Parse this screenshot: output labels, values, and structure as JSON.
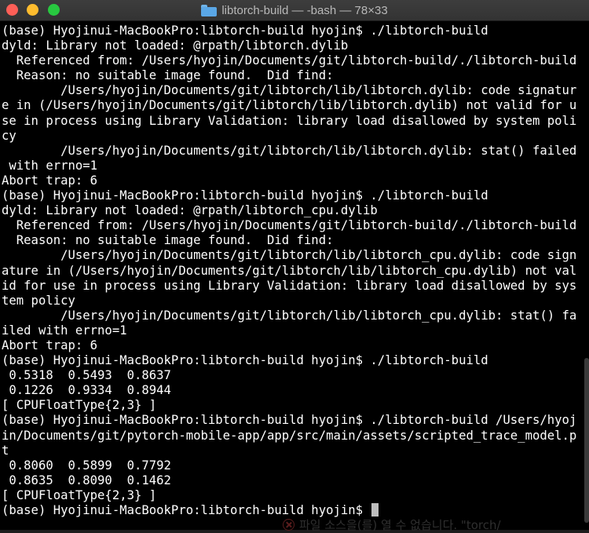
{
  "window": {
    "title": "libtorch-build — -bash — 78×33",
    "folder_icon": "folder-icon"
  },
  "terminal": {
    "lines": [
      "(base) Hyojinui-MacBookPro:libtorch-build hyojin$ ./libtorch-build",
      "dyld: Library not loaded: @rpath/libtorch.dylib",
      "  Referenced from: /Users/hyojin/Documents/git/libtorch-build/./libtorch-build",
      "  Reason: no suitable image found.  Did find:",
      "        /Users/hyojin/Documents/git/libtorch/lib/libtorch.dylib: code signatur",
      "e in (/Users/hyojin/Documents/git/libtorch/lib/libtorch.dylib) not valid for u",
      "se in process using Library Validation: library load disallowed by system poli",
      "cy",
      "        /Users/hyojin/Documents/git/libtorch/lib/libtorch.dylib: stat() failed",
      " with errno=1",
      "Abort trap: 6",
      "(base) Hyojinui-MacBookPro:libtorch-build hyojin$ ./libtorch-build",
      "dyld: Library not loaded: @rpath/libtorch_cpu.dylib",
      "  Referenced from: /Users/hyojin/Documents/git/libtorch-build/./libtorch-build",
      "  Reason: no suitable image found.  Did find:",
      "        /Users/hyojin/Documents/git/libtorch/lib/libtorch_cpu.dylib: code sign",
      "ature in (/Users/hyojin/Documents/git/libtorch/lib/libtorch_cpu.dylib) not val",
      "id for use in process using Library Validation: library load disallowed by sys",
      "tem policy",
      "        /Users/hyojin/Documents/git/libtorch/lib/libtorch_cpu.dylib: stat() fa",
      "iled with errno=1",
      "Abort trap: 6",
      "(base) Hyojinui-MacBookPro:libtorch-build hyojin$ ./libtorch-build",
      " 0.5318  0.5493  0.8637",
      " 0.1226  0.9334  0.8944",
      "[ CPUFloatType{2,3} ]",
      "(base) Hyojinui-MacBookPro:libtorch-build hyojin$ ./libtorch-build /Users/hyoj",
      "in/Documents/git/pytorch-mobile-app/app/src/main/assets/scripted_trace_model.p",
      "t",
      " 0.8060  0.5899  0.7792",
      " 0.8635  0.8090  0.1462",
      "[ CPUFloatType{2,3} ]",
      "(base) Hyojinui-MacBookPro:libtorch-build hyojin$ "
    ]
  },
  "overlay": {
    "text": "파일 소스을(를) 열 수 없습니다. \"torch/"
  }
}
